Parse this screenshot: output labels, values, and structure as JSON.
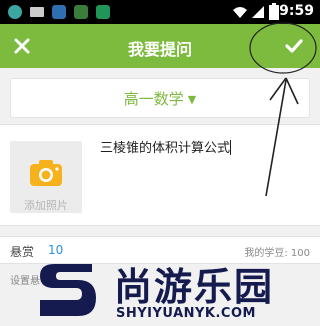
{
  "status_bar": {
    "time": "9:59",
    "icons": [
      "app-icon",
      "mail-icon",
      "app-icon",
      "app-icon",
      "app-icon",
      "wifi-icon",
      "signal-icon",
      "battery-icon"
    ]
  },
  "header": {
    "title": "我要提问",
    "bg_color": "#7dbb3f"
  },
  "subject": {
    "selected": "高一数学"
  },
  "question": {
    "photo_label": "添加照片",
    "text": "三棱锥的体积计算公式"
  },
  "reward": {
    "label": "悬赏",
    "value": "10",
    "beans": "我的学豆: 100"
  },
  "hint": {
    "text": "设置悬"
  },
  "watermark": {
    "text": "尚游乐园",
    "url": "SHYIYUANYK.COM"
  }
}
